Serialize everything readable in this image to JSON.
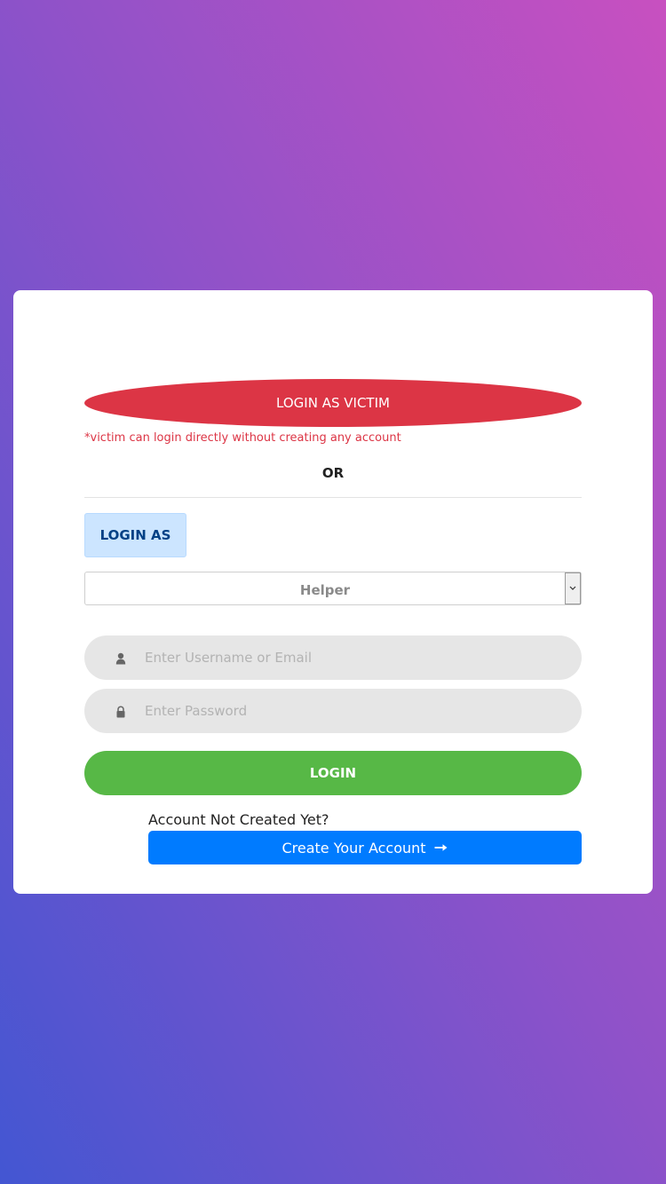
{
  "victim_login": {
    "button_label": "LOGIN AS VICTIM",
    "note": "*victim can login directly without creating any account"
  },
  "separator_text": "OR",
  "role_selector": {
    "label": "LOGIN AS",
    "selected_value": "Helper",
    "dropdown_icon": "chevron-down-icon"
  },
  "login_form": {
    "username_placeholder": "Enter Username or Email",
    "username_icon": "user-icon",
    "password_placeholder": "Enter Password",
    "password_icon": "lock-icon",
    "submit_label": "LOGIN"
  },
  "signup": {
    "prompt": "Account Not Created Yet?",
    "button_label": "Create Your Account",
    "button_icon": "arrow-right-icon"
  },
  "colors": {
    "victim_button": "#dc3545",
    "login_button": "#57b846",
    "create_button": "#007bff",
    "label_background": "#cce5ff",
    "label_text": "#004085",
    "input_background": "#e6e6e6"
  }
}
